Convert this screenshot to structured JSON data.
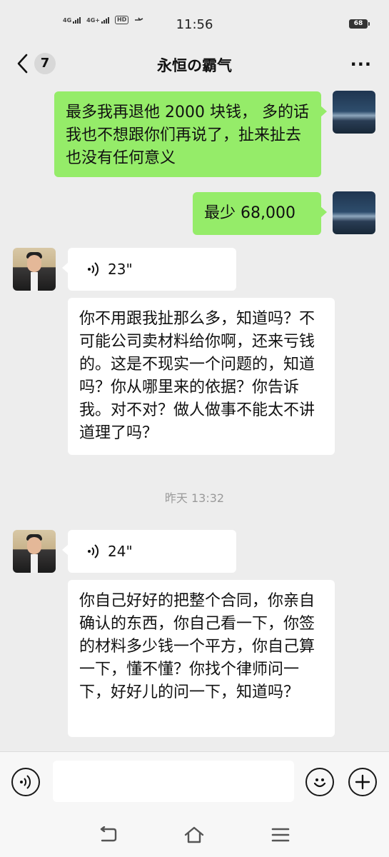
{
  "status_bar": {
    "signal1": "4G",
    "signal2": "4G+",
    "hd": "HD",
    "time": "11:56",
    "battery": "68"
  },
  "header": {
    "unread_count": "7",
    "title": "永恒の霸气",
    "more_label": "···"
  },
  "messages": [
    {
      "sender": "self",
      "type": "text",
      "text": "最多我再退他 2000 块钱， 多的话我也不想跟你们再说了，扯来扯去也没有任何意义"
    },
    {
      "sender": "self",
      "type": "text",
      "text": "最少 68,000"
    },
    {
      "sender": "other",
      "type": "voice",
      "duration": "23\""
    },
    {
      "sender": "other",
      "type": "text",
      "text": "你不用跟我扯那么多，知道吗？不可能公司卖材料给你啊，还来亏钱的。这是不现实一个问题的，知道吗？你从哪里来的依据？你告诉我。对不对？做人做事不能太不讲道理了吗？"
    },
    {
      "sender": "other",
      "type": "voice",
      "duration": "24\""
    },
    {
      "sender": "other",
      "type": "text",
      "text": "你自己好好的把整个合同，你亲自确认的东西，你自己看一下，你签的材料多少钱一个平方，你自己算一下，懂不懂？你找个律师问一下，好好儿的问一下，知道吗？"
    }
  ],
  "timestamp": "昨天 13:32",
  "input_bar": {
    "placeholder": ""
  },
  "colors": {
    "self_bubble": "#95ec69",
    "other_bubble": "#ffffff",
    "background": "#ededed"
  },
  "icons": [
    "signal-icon",
    "hd-icon",
    "battery-icon",
    "back-icon",
    "more-icon",
    "voice-wave-icon",
    "voice-input-icon",
    "emoji-icon",
    "plus-icon",
    "nav-back-icon",
    "nav-home-icon",
    "nav-menu-icon"
  ]
}
